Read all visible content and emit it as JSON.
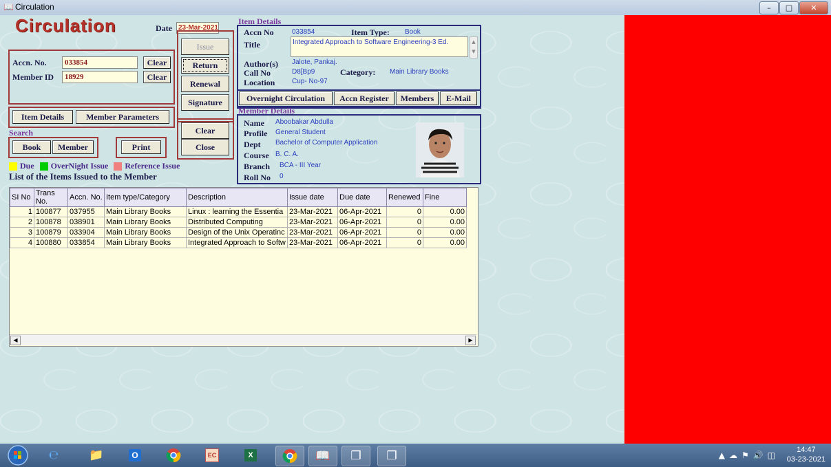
{
  "window": {
    "title": "Circulation",
    "icon": "book-icon"
  },
  "header": {
    "title": "Circulation",
    "date_label": "Date",
    "date_value": "23-Mar-2021"
  },
  "lookup": {
    "accn_label": "Accn. No.",
    "accn_value": "033854",
    "accn_clear": "Clear",
    "member_label": "Member ID",
    "member_value": "18929",
    "member_clear": "Clear"
  },
  "actions": {
    "issue": "Issue",
    "return": "Return",
    "renewal": "Renewal",
    "signature": "Signature",
    "clear": "Clear",
    "close": "Close"
  },
  "tabs_left": {
    "item_details": "Item Details",
    "member_parameters": "Member Parameters"
  },
  "search": {
    "label": "Search",
    "book": "Book",
    "member": "Member",
    "print": "Print"
  },
  "legend": {
    "due": "Due",
    "overnight": "OverNight Issue",
    "reference": "Reference Issue",
    "colors": {
      "due": "#ffff00",
      "overnight": "#00cc00",
      "reference": "#f08080"
    }
  },
  "list_title": "List of the Items Issued to the Member",
  "item_details": {
    "section": "Item Details",
    "accn_label": "Accn No",
    "accn_value": "033854",
    "type_label": "Item Type:",
    "type_value": "Book",
    "title_label": "Title",
    "title_value": "Integrated Approach to Software Engineering-3 Ed.",
    "author_label": "Author(s)",
    "author_value": "Jalote, Pankaj.",
    "call_label": "Call No",
    "call_value": "D8[Bp9",
    "category_label": "Category:",
    "category_value": "Main Library Books",
    "location_label": "Location",
    "location_value": "Cup- No-97"
  },
  "nav_buttons": {
    "overnight": "Overnight Circulation",
    "accn_register": "Accn Register",
    "members": "Members",
    "email": "E-Mail"
  },
  "member_details": {
    "section": "Member Details",
    "name_label": "Name",
    "name_value": "Aboobakar Abdulla",
    "profile_label": "Profile",
    "profile_value": "General Student",
    "dept_label": "Dept",
    "dept_value": "Bachelor of Computer Application",
    "course_label": "Course",
    "course_value": "B. C. A.",
    "branch_label": "Branch",
    "branch_value": "BCA - III Year",
    "roll_label": "Roll No",
    "roll_value": "0"
  },
  "table": {
    "columns": [
      "SI No",
      "Trans No.",
      "Accn. No.",
      "Item type/Category",
      "Description",
      "Issue date",
      "Due date",
      "Renewed",
      "Fine"
    ],
    "rows": [
      [
        "1",
        "100877",
        "037955",
        "Main Library Books",
        "Linux : learning the Essentia",
        "23-Mar-2021",
        "06-Apr-2021",
        "0",
        "0.00"
      ],
      [
        "2",
        "100878",
        "038901",
        "Main Library Books",
        "Distributed Computing",
        "23-Mar-2021",
        "06-Apr-2021",
        "0",
        "0.00"
      ],
      [
        "3",
        "100879",
        "033904",
        "Main Library Books",
        "Design of the Unix Operatinc",
        "23-Mar-2021",
        "06-Apr-2021",
        "0",
        "0.00"
      ],
      [
        "4",
        "100880",
        "033854",
        "Main Library Books",
        "Integrated Approach to Softw",
        "23-Mar-2021",
        "06-Apr-2021",
        "0",
        "0.00"
      ]
    ]
  },
  "taskbar": {
    "time": "14:47",
    "date": "03-23-2021",
    "icons": [
      "start-orb-icon",
      "internet-explorer-icon",
      "file-explorer-icon",
      "outlook-icon",
      "chrome-icon",
      "calendar-app-icon",
      "excel-icon",
      "chrome-alt-icon",
      "library-app-icon",
      "window-app-icon",
      "window-app-icon-2"
    ]
  }
}
